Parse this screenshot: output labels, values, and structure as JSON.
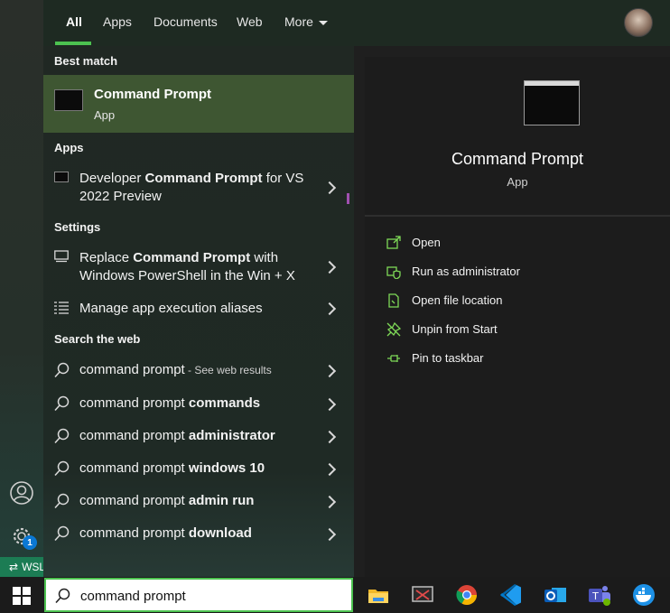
{
  "header": {
    "tabs": [
      {
        "label": "All",
        "active": true
      },
      {
        "label": "Apps"
      },
      {
        "label": "Documents"
      },
      {
        "label": "Web"
      },
      {
        "label": "More"
      }
    ]
  },
  "results": {
    "best_match_heading": "Best match",
    "best_match": {
      "title": "Command Prompt",
      "subtitle": "App"
    },
    "apps_heading": "Apps",
    "apps": [
      {
        "pre": "Developer ",
        "bold": "Command Prompt",
        "post": " for VS",
        "line2": "2022 Preview"
      }
    ],
    "settings_heading": "Settings",
    "settings": [
      {
        "pre": "Replace ",
        "bold": "Command Prompt",
        "post": " with",
        "line2": "Windows PowerShell in the Win + X"
      },
      {
        "label": "Manage app execution aliases"
      }
    ],
    "web_heading": "Search the web",
    "web": [
      {
        "pre": "command prompt",
        "bold": "",
        "hint": " - See web results"
      },
      {
        "pre": "command prompt ",
        "bold": "commands"
      },
      {
        "pre": "command prompt ",
        "bold": "administrator"
      },
      {
        "pre": "command prompt ",
        "bold": "windows 10"
      },
      {
        "pre": "command prompt ",
        "bold": "admin run"
      },
      {
        "pre": "command prompt ",
        "bold": "download"
      }
    ]
  },
  "detail": {
    "name": "Command Prompt",
    "kind": "App",
    "actions": [
      {
        "label": "Open",
        "icon": "open-icon"
      },
      {
        "label": "Run as administrator",
        "icon": "shield-icon"
      },
      {
        "label": "Open file location",
        "icon": "file-location-icon"
      },
      {
        "label": "Unpin from Start",
        "icon": "unpin-icon"
      },
      {
        "label": "Pin to taskbar",
        "icon": "pin-icon"
      }
    ]
  },
  "rail": {
    "badge_count": "1",
    "wsl_label": "WSL"
  },
  "search": {
    "value": "command prompt"
  },
  "colors": {
    "accent": "#4cc250",
    "best_match_bg": "#3e5632",
    "action_icon": "#7ed957"
  }
}
